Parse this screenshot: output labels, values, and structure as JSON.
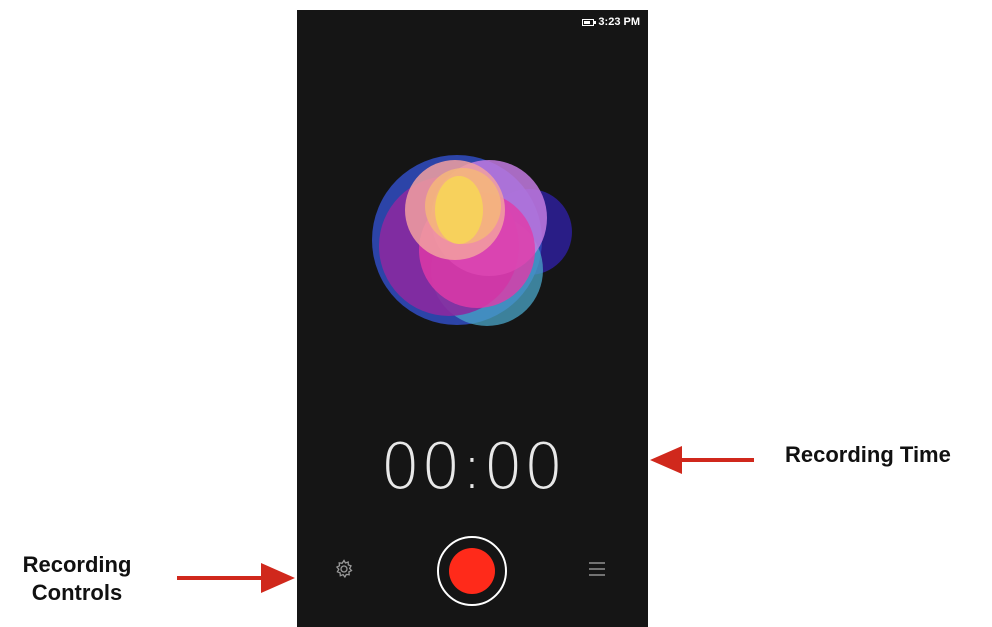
{
  "status_bar": {
    "time": "3:23 PM",
    "battery_icon": "battery-icon"
  },
  "recorder": {
    "timer": "00:00",
    "record_color": "#ff2a1a",
    "background_color": "#151515"
  },
  "controls": {
    "settings_icon": "gear-icon",
    "record_icon": "record-icon",
    "list_icon": "menu-list-icon"
  },
  "annotations": {
    "recording_time": "Recording Time",
    "recording_controls_line1": "Recording",
    "recording_controls_line2": "Controls",
    "arrow_color": "#d0281c"
  }
}
